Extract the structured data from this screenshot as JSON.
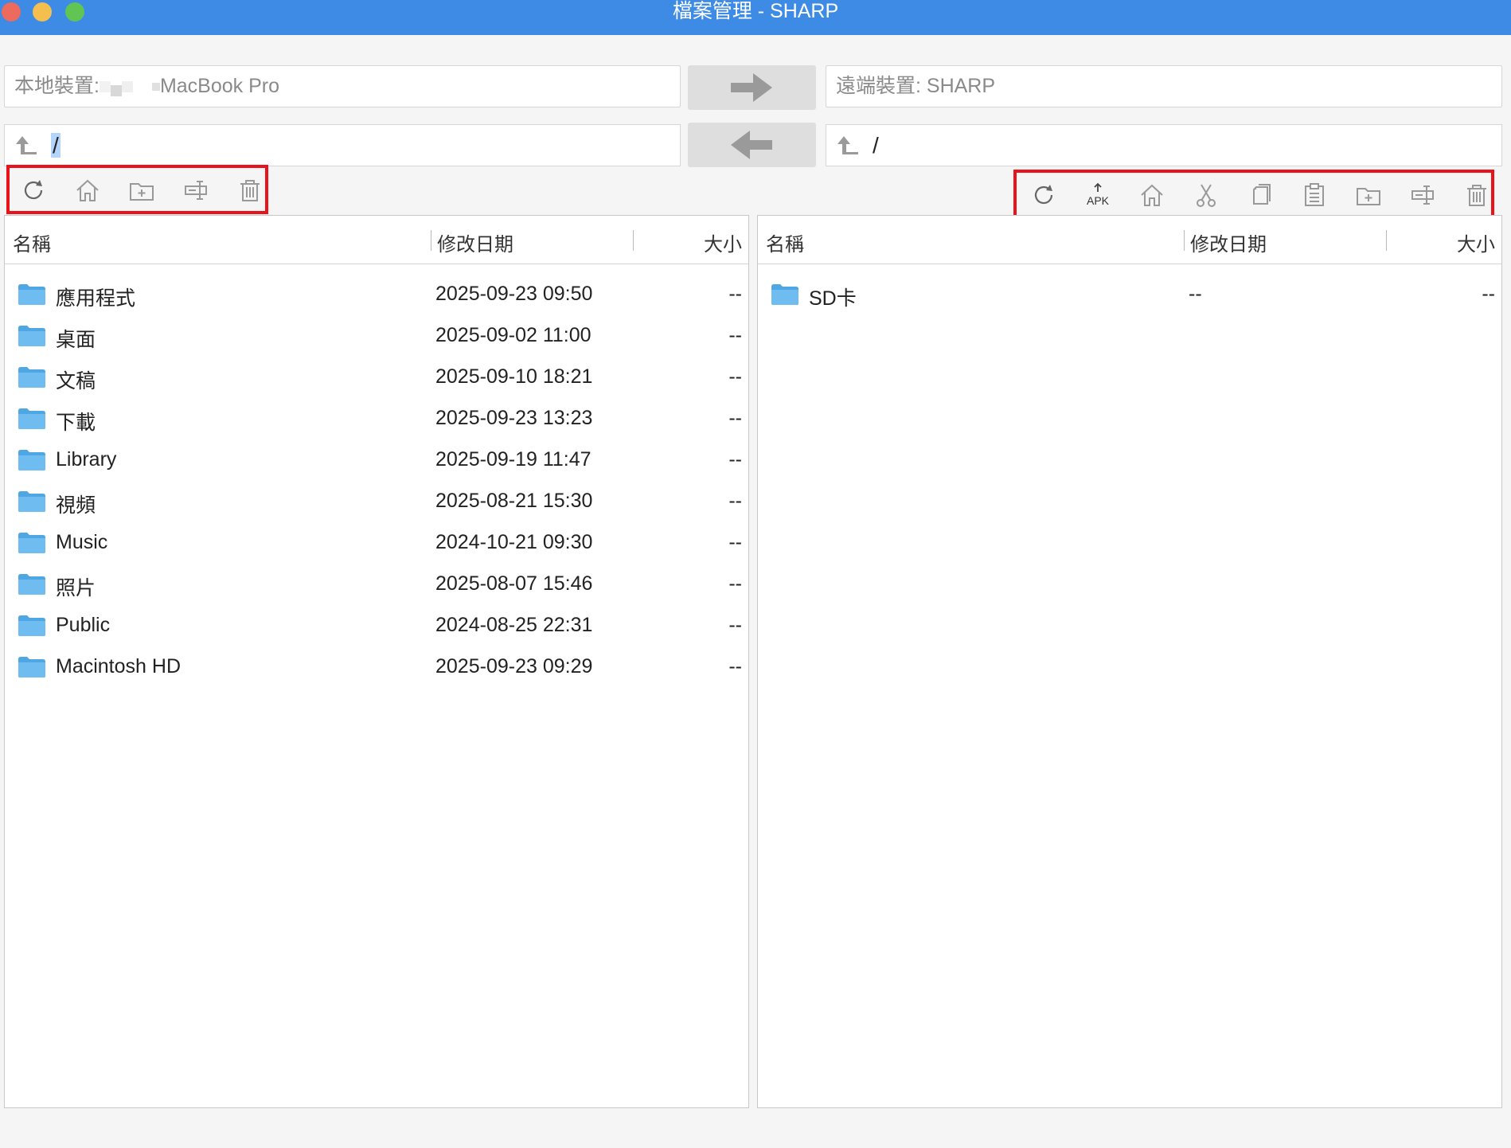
{
  "window": {
    "title": "檔案管理 - SHARP"
  },
  "local": {
    "device_prefix": "本地裝置:",
    "device_name": "MacBook Pro",
    "path": "/",
    "columns": {
      "name": "名稱",
      "date": "修改日期",
      "size": "大小"
    },
    "rows": [
      {
        "name": "應用程式",
        "date": "2025-09-23 09:50",
        "size": "--"
      },
      {
        "name": "桌面",
        "date": "2025-09-02 11:00",
        "size": "--"
      },
      {
        "name": "文稿",
        "date": "2025-09-10 18:21",
        "size": "--"
      },
      {
        "name": "下載",
        "date": "2025-09-23 13:23",
        "size": "--"
      },
      {
        "name": "Library",
        "date": "2025-09-19 11:47",
        "size": "--"
      },
      {
        "name": "視頻",
        "date": "2025-08-21 15:30",
        "size": "--"
      },
      {
        "name": "Music",
        "date": "2024-10-21 09:30",
        "size": "--"
      },
      {
        "name": "照片",
        "date": "2025-08-07 15:46",
        "size": "--"
      },
      {
        "name": "Public",
        "date": "2024-08-25 22:31",
        "size": "--"
      },
      {
        "name": "Macintosh HD",
        "date": "2025-09-23 09:29",
        "size": "--"
      }
    ],
    "toolbar": [
      "refresh-icon",
      "home-icon",
      "new-folder-icon",
      "rename-icon",
      "trash-icon"
    ]
  },
  "remote": {
    "device_label": "遠端裝置: SHARP",
    "path": "/",
    "columns": {
      "name": "名稱",
      "date": "修改日期",
      "size": "大小"
    },
    "rows": [
      {
        "name": "SD卡",
        "date": "--",
        "size": "--"
      }
    ],
    "toolbar": [
      "refresh-icon",
      "apk-install-icon",
      "home-icon",
      "cut-icon",
      "copy-icon",
      "paste-icon",
      "new-folder-icon",
      "rename-icon",
      "trash-icon"
    ],
    "apk_label": "APK"
  },
  "colors": {
    "titlebar": "#3d8be5",
    "highlight_border": "#e8131b",
    "folder": "#5aaee6"
  }
}
